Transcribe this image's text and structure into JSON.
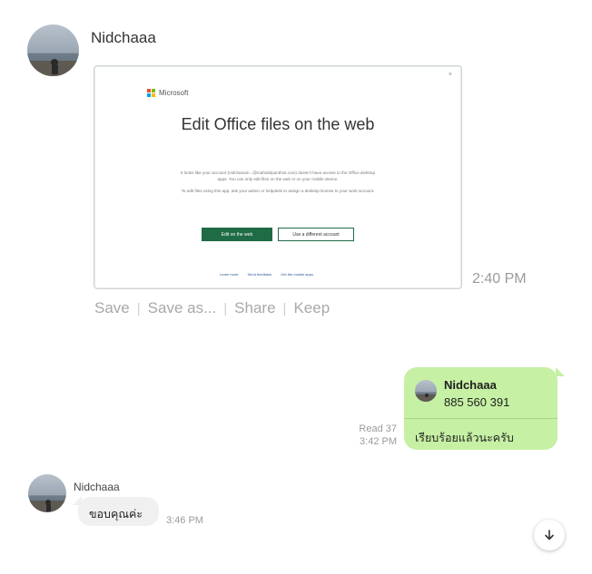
{
  "message1": {
    "sender": "Nidchaaa",
    "time": "2:40 PM",
    "screenshot": {
      "brand": "Microsoft",
      "title": "Edit Office files on the web",
      "body_line1": "It looks like your account (nidchanam...@mahidolpanthos.com) doesn't have access to the Office desktop",
      "body_line2": "apps. You can only edit files on the web or on your mobile device.",
      "body_line3": "To edit files using this app, ask your admin or helpdesk to assign a desktop license to your work account.",
      "primary_button": "Edit on the web",
      "secondary_button": "Use a different account",
      "link1": "Learn more",
      "link2": "Send feedback",
      "link3": "Get the mobile apps"
    },
    "actions": [
      "Save",
      "Save as...",
      "Share",
      "Keep"
    ]
  },
  "message2": {
    "contact_name": "Nidchaaa",
    "contact_number": "885 560 391",
    "text": "เรียบร้อยแล้วนะครับ",
    "read_label": "Read 37",
    "time": "3:42 PM",
    "colors": {
      "bubble": "#c6f0a4"
    }
  },
  "message3": {
    "sender": "Nidchaaa",
    "text": "ขอบคุณค่ะ",
    "time": "3:46 PM"
  },
  "scroll_button": {
    "icon": "arrow-down-icon"
  }
}
